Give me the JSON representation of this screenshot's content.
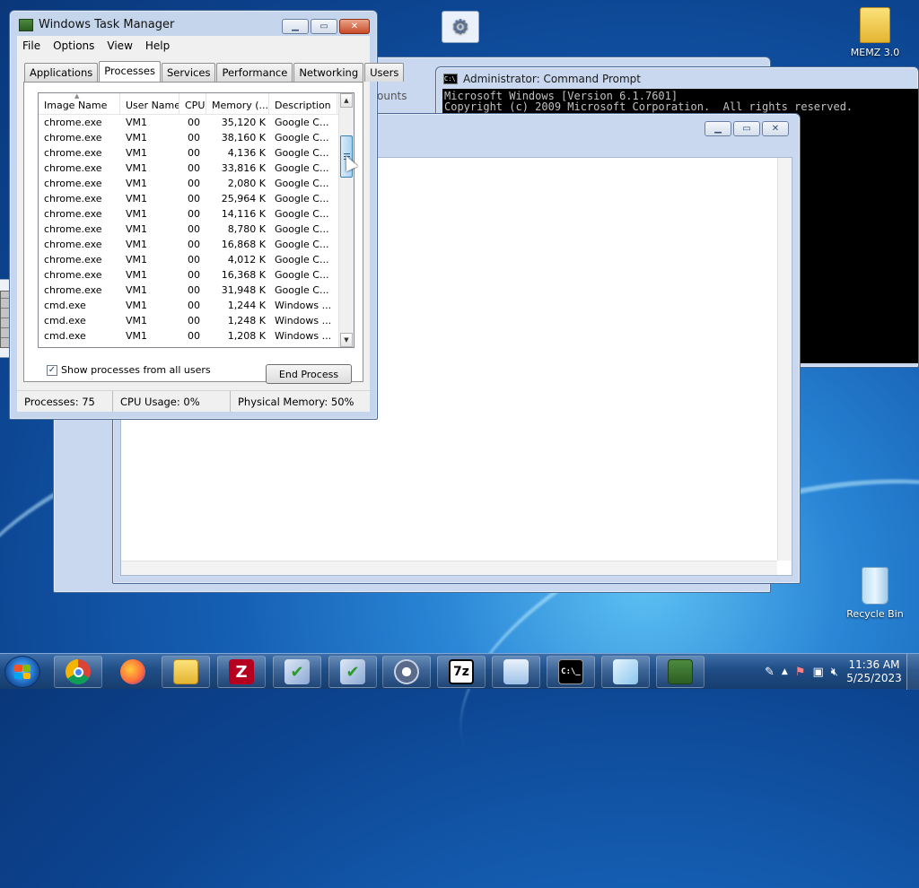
{
  "desktop": {
    "icons": [
      {
        "label": "MEMZ 3.0",
        "icon": "folder-icon"
      },
      {
        "label": "Recycle Bin",
        "icon": "recycle-bin-icon"
      },
      {
        "label": "",
        "icon": "gear-settings-icon"
      }
    ]
  },
  "background_window": {
    "text": "ounts"
  },
  "cmd": {
    "title": "Administrator: Command Prompt",
    "icon_text": "C:\\",
    "lines": [
      "Microsoft Windows [Version 6.1.7601]",
      "Copyright (c) 2009 Microsoft Corporation.  All rights reserved."
    ]
  },
  "taskman": {
    "title": "Windows Task Manager",
    "menu": [
      "File",
      "Options",
      "View",
      "Help"
    ],
    "tabs": [
      "Applications",
      "Processes",
      "Services",
      "Performance",
      "Networking",
      "Users"
    ],
    "active_tab": "Processes",
    "columns": [
      "Image Name",
      "User Name",
      "CPU",
      "Memory (...",
      "Description"
    ],
    "rows": [
      [
        "chrome.exe",
        "VM1",
        "00",
        "35,120 K",
        "Google C..."
      ],
      [
        "chrome.exe",
        "VM1",
        "00",
        "38,160 K",
        "Google C..."
      ],
      [
        "chrome.exe",
        "VM1",
        "00",
        "4,136 K",
        "Google C..."
      ],
      [
        "chrome.exe",
        "VM1",
        "00",
        "33,816 K",
        "Google C..."
      ],
      [
        "chrome.exe",
        "VM1",
        "00",
        "2,080 K",
        "Google C..."
      ],
      [
        "chrome.exe",
        "VM1",
        "00",
        "25,964 K",
        "Google C..."
      ],
      [
        "chrome.exe",
        "VM1",
        "00",
        "14,116 K",
        "Google C..."
      ],
      [
        "chrome.exe",
        "VM1",
        "00",
        "8,780 K",
        "Google C..."
      ],
      [
        "chrome.exe",
        "VM1",
        "00",
        "16,868 K",
        "Google C..."
      ],
      [
        "chrome.exe",
        "VM1",
        "00",
        "4,012 K",
        "Google C..."
      ],
      [
        "chrome.exe",
        "VM1",
        "00",
        "16,368 K",
        "Google C..."
      ],
      [
        "chrome.exe",
        "VM1",
        "00",
        "31,948 K",
        "Google C..."
      ],
      [
        "cmd.exe",
        "VM1",
        "00",
        "1,244 K",
        "Windows ..."
      ],
      [
        "cmd.exe",
        "VM1",
        "00",
        "1,248 K",
        "Windows ..."
      ],
      [
        "cmd.exe",
        "VM1",
        "00",
        "1,208 K",
        "Windows ..."
      ]
    ],
    "show_all_label": "Show processes from all users",
    "show_all_checked": true,
    "end_process_label": "End Process",
    "status": {
      "processes": "Processes: 75",
      "cpu": "CPU Usage: 0%",
      "memory": "Physical Memory: 50%"
    }
  },
  "taskbar": {
    "pinned": [
      "chrome-icon",
      "firefox-icon",
      "explorer-icon",
      "filezilla-icon",
      "installer-icon",
      "installer-icon-2",
      "media-player-icon",
      "7zip-icon",
      "control-panel-icon",
      "cmd-icon",
      "notepad-icon",
      "task-manager-icon"
    ],
    "icon_labels": {
      "sevenzip": "7z",
      "cmd": "C:\\_"
    },
    "clock_time": "11:36 AM",
    "clock_date": "5/25/2023"
  },
  "colors": {
    "desktop_blue": "#155fb4",
    "taskbar": "#1f4d86",
    "close_red": "#c84a28",
    "scroll_thumb": "#a9d2f1"
  }
}
